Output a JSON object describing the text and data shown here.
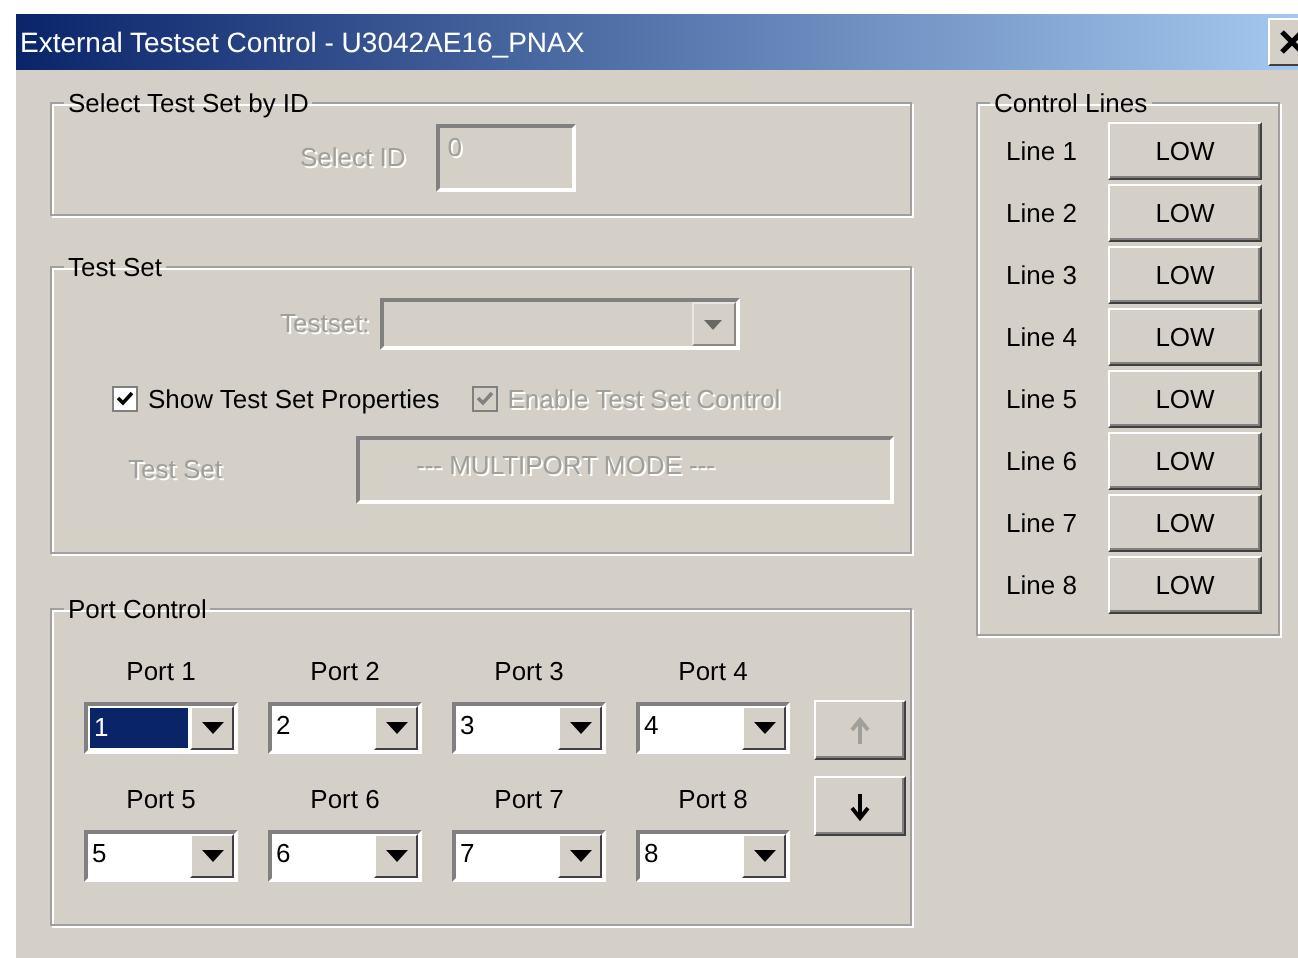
{
  "window": {
    "title": "External Testset Control - U3042AE16_PNAX"
  },
  "select_by_id": {
    "title": "Select Test Set by ID",
    "label": "Select ID",
    "value": "0",
    "disabled": true
  },
  "test_set": {
    "title": "Test Set",
    "testset_label": "Testset:",
    "testset_disabled": true,
    "checkboxes": [
      {
        "label": "Show Test Set Properties",
        "checked": true,
        "disabled": false
      },
      {
        "label": "Enable Test Set Control",
        "checked": true,
        "disabled": true
      }
    ],
    "name_label": "Test Set",
    "name_value": "--- MULTIPORT MODE ---"
  },
  "port_control": {
    "title": "Port Control",
    "ports": [
      {
        "label": "Port 1",
        "value": "1",
        "selected": true
      },
      {
        "label": "Port 2",
        "value": "2",
        "selected": false
      },
      {
        "label": "Port 3",
        "value": "3",
        "selected": false
      },
      {
        "label": "Port 4",
        "value": "4",
        "selected": false
      },
      {
        "label": "Port 5",
        "value": "5",
        "selected": false
      },
      {
        "label": "Port 6",
        "value": "6",
        "selected": false
      },
      {
        "label": "Port 7",
        "value": "7",
        "selected": false
      },
      {
        "label": "Port 8",
        "value": "8",
        "selected": false
      }
    ],
    "buttons": [
      {
        "kind": "up",
        "disabled": true
      },
      {
        "kind": "down",
        "disabled": false
      }
    ]
  },
  "control_lines": {
    "title": "Control Lines",
    "lines": [
      {
        "label": "Line 1",
        "value": "LOW"
      },
      {
        "label": "Line 2",
        "value": "LOW"
      },
      {
        "label": "Line 3",
        "value": "LOW"
      },
      {
        "label": "Line 4",
        "value": "LOW"
      },
      {
        "label": "Line 5",
        "value": "LOW"
      },
      {
        "label": "Line 6",
        "value": "LOW"
      },
      {
        "label": "Line 7",
        "value": "LOW"
      },
      {
        "label": "Line 8",
        "value": "LOW"
      }
    ]
  }
}
